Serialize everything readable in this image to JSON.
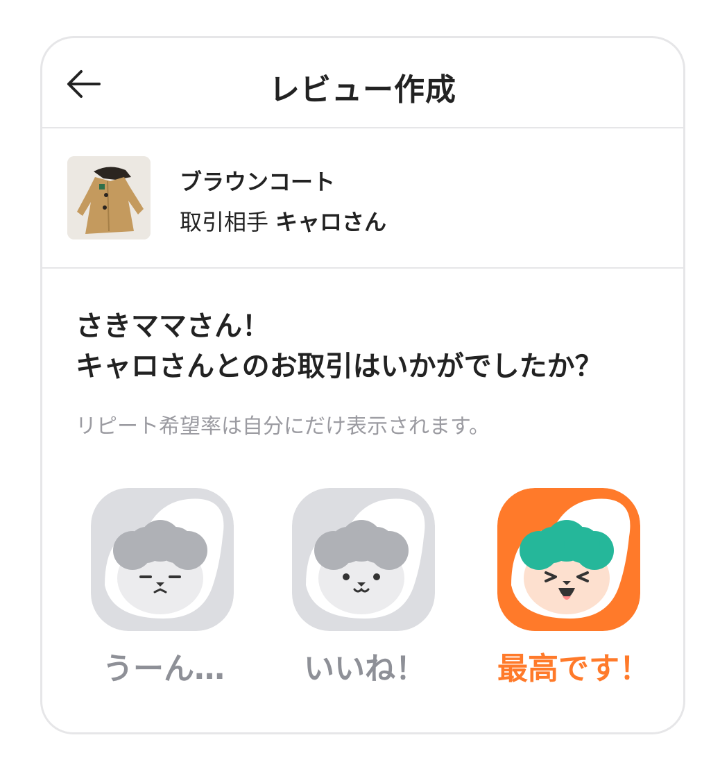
{
  "header": {
    "title": "レビュー作成",
    "back_icon": "arrow-left-icon"
  },
  "item": {
    "name": "ブラウンコート",
    "partner_label": "取引相手",
    "partner_name": "キャロさん"
  },
  "prompt": {
    "line1": "さきママさん！",
    "line2": "キャロさんとのお取引はいかがでしたか？",
    "note": "リピート希望率は自分にだけ表示されます。"
  },
  "choices": [
    {
      "label": "うーん…",
      "icon": "meh-face-icon",
      "selected": false
    },
    {
      "label": "いいね！",
      "icon": "smile-face-icon",
      "selected": false
    },
    {
      "label": "最高です！",
      "icon": "laugh-face-icon",
      "selected": true
    }
  ],
  "colors": {
    "accent": "#ff7a2a",
    "inactive": "#dcdde1",
    "hair_selected": "#25b79a",
    "text_muted": "#9b9ba1"
  }
}
